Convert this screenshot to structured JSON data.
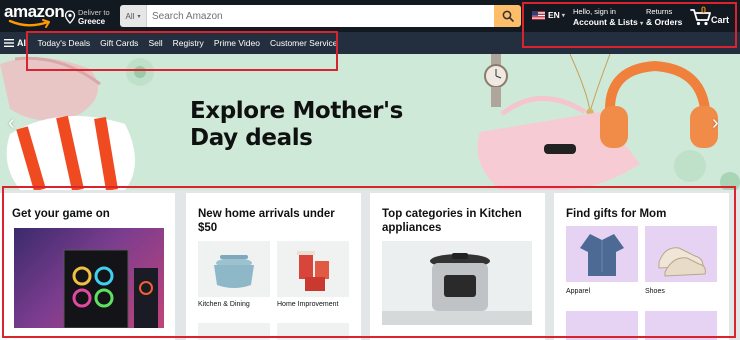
{
  "header": {
    "logo": "amazon",
    "deliver": {
      "line1": "Deliver to",
      "line2": "Greece"
    },
    "search": {
      "category": "All",
      "placeholder": "Search Amazon"
    },
    "language": "EN",
    "account": {
      "line1": "Hello, sign in",
      "line2": "Account & Lists"
    },
    "returns": {
      "line1": "Returns",
      "line2": "& Orders"
    },
    "cart": {
      "count": "0",
      "label": "Cart"
    }
  },
  "nav": {
    "all_label": "All",
    "items": [
      "Today's Deals",
      "Gift Cards",
      "Sell",
      "Registry",
      "Prime Video",
      "Customer Service"
    ]
  },
  "hero": {
    "title": "Explore Mother's Day deals"
  },
  "cards": [
    {
      "title": "Get your game on",
      "tiles": []
    },
    {
      "title": "New home arrivals under $50",
      "tiles": [
        "Kitchen & Dining",
        "Home Improvement"
      ]
    },
    {
      "title": "Top categories in Kitchen appliances",
      "tiles": []
    },
    {
      "title": "Find gifts for Mom",
      "tiles": [
        "Apparel",
        "Shoes"
      ]
    }
  ],
  "icons": {
    "logo_smile": "smile-arrow-icon",
    "location": "location-pin-icon",
    "search": "magnifier-icon",
    "flag": "us-flag-icon",
    "cart": "cart-icon",
    "menu": "hamburger-icon"
  },
  "colors": {
    "header_bg": "#131921",
    "nav_bg": "#232f3e",
    "search_button": "#febd69",
    "hero_bg": "#cfe9d8",
    "cart_count": "#f08804",
    "annotation": "#d9232e"
  }
}
